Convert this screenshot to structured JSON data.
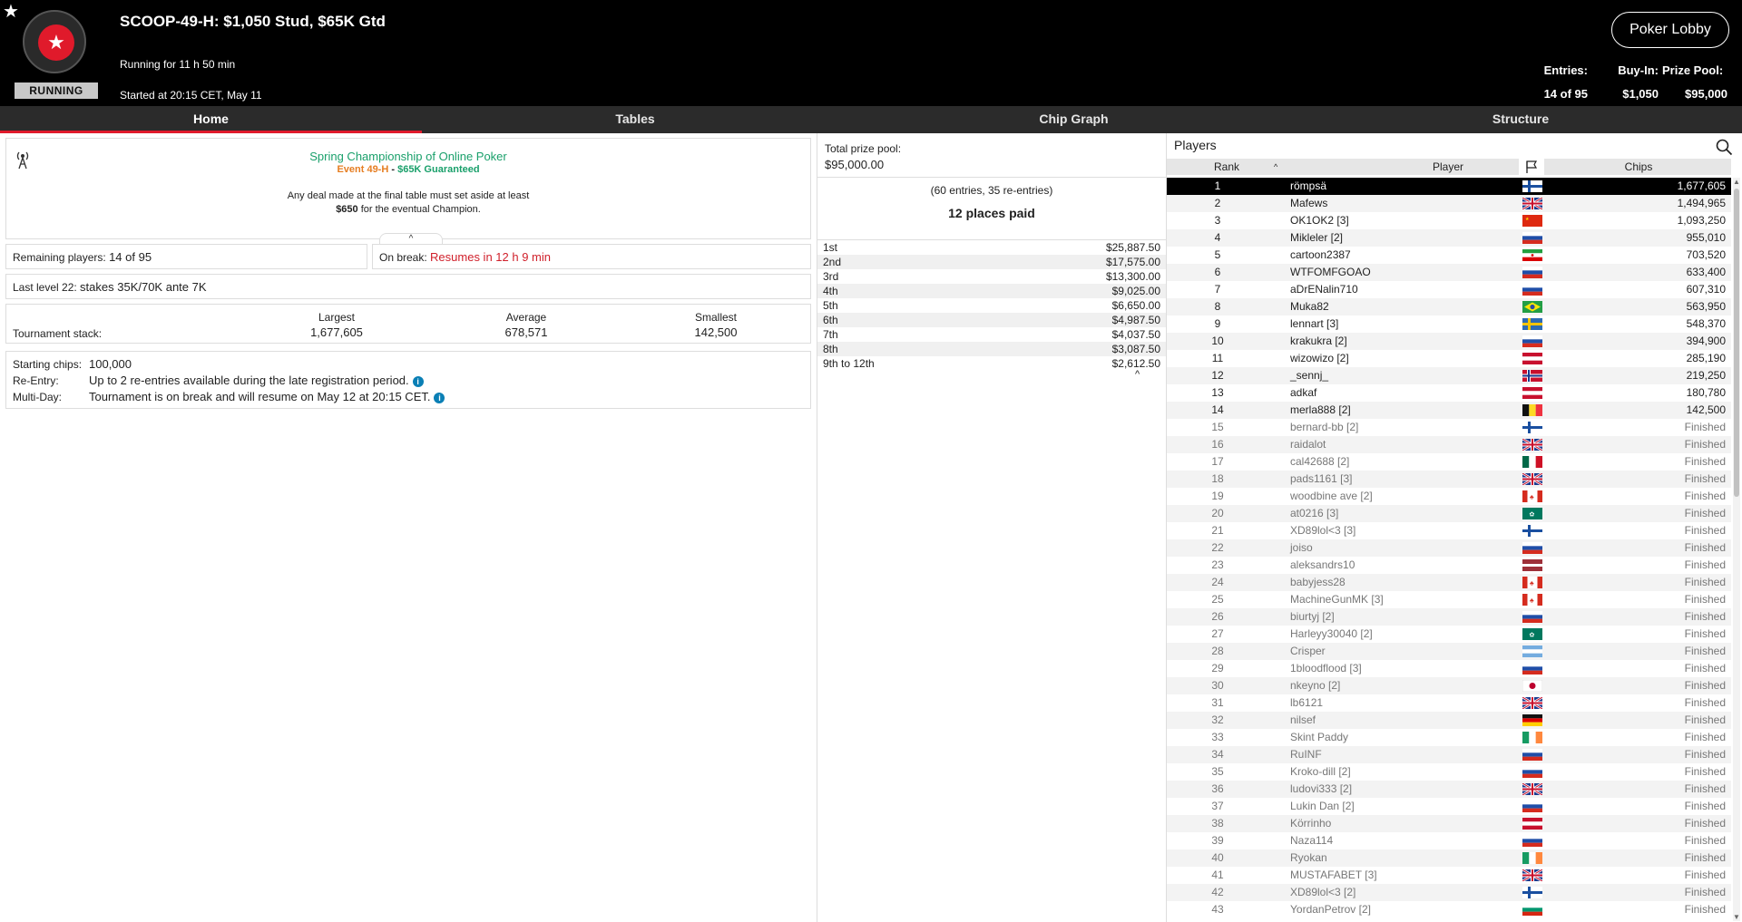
{
  "header": {
    "title": "SCOOP-49-H: $1,050 Stud, $65K Gtd",
    "running_for": "Running for 11 h 50 min",
    "started_at": "Started at 20:15 CET, May 11",
    "status_badge": "RUNNING",
    "lobby_button": "Poker Lobby",
    "stats": [
      {
        "label": "Entries:",
        "value": "14 of 95"
      },
      {
        "label": "Buy-In:",
        "value": "$1,050"
      },
      {
        "label": "Prize Pool:",
        "value": "$95,000"
      }
    ]
  },
  "tabs": [
    {
      "label": "Home",
      "active": true
    },
    {
      "label": "Tables",
      "active": false
    },
    {
      "label": "Chip Graph",
      "active": false
    },
    {
      "label": "Structure",
      "active": false
    }
  ],
  "promo": {
    "title": "Spring Championship of Online Poker",
    "event": "Event 49-H",
    "separator": " - ",
    "guarantee": "$65K Guaranteed",
    "deal_line1": "Any deal made at the final table must set aside at least",
    "deal_amount": "$650",
    "deal_line2": " for the eventual Champion."
  },
  "status": {
    "remaining_label": "Remaining players: ",
    "remaining_value": "14 of 95",
    "onbreak_label": "On break: ",
    "onbreak_value": "Resumes in 12 h 9 min",
    "lastlevel_label": "Last level 22: ",
    "lastlevel_value": "stakes 35K/70K ante 7K"
  },
  "stacks": {
    "row_label": "Tournament stack:",
    "largest_label": "Largest",
    "largest": "1,677,605",
    "average_label": "Average",
    "average": "678,571",
    "smallest_label": "Smallest",
    "smallest": "142,500"
  },
  "info": {
    "starting_chips_label": "Starting chips:",
    "starting_chips": "100,000",
    "reentry_label": "Re-Entry:",
    "reentry": "Up to 2 re-entries available during the late registration period.",
    "multiday_label": "Multi-Day:",
    "multiday": "Tournament is on break and will resume on May 12 at 20:15 CET."
  },
  "prizes": {
    "total_label": "Total prize pool:",
    "total_value": "$95,000.00",
    "entries_note": "(60 entries, 35 re-entries)",
    "places_paid": "12 places paid",
    "payouts": [
      {
        "place": "1st",
        "amount": "$25,887.50"
      },
      {
        "place": "2nd",
        "amount": "$17,575.00"
      },
      {
        "place": "3rd",
        "amount": "$13,300.00"
      },
      {
        "place": "4th",
        "amount": "$9,025.00"
      },
      {
        "place": "5th",
        "amount": "$6,650.00"
      },
      {
        "place": "6th",
        "amount": "$4,987.50"
      },
      {
        "place": "7th",
        "amount": "$4,037.50"
      },
      {
        "place": "8th",
        "amount": "$3,087.50"
      },
      {
        "place": "9th to 12th",
        "amount": "$2,612.50"
      }
    ]
  },
  "players": {
    "title": "Players",
    "columns": {
      "rank": "Rank",
      "player": "Player",
      "chips": "Chips"
    },
    "rows": [
      {
        "rank": "1",
        "name": "römpsä",
        "flag": "fi",
        "chips": "1,677,605"
      },
      {
        "rank": "2",
        "name": "Mafews",
        "flag": "gb",
        "chips": "1,494,965"
      },
      {
        "rank": "3",
        "name": "OK1OK2 [3]",
        "flag": "cn",
        "chips": "1,093,250"
      },
      {
        "rank": "4",
        "name": "Mikleler [2]",
        "flag": "ru",
        "chips": "955,010"
      },
      {
        "rank": "5",
        "name": "cartoon2387",
        "flag": "ir",
        "chips": "703,520"
      },
      {
        "rank": "6",
        "name": "WTFOMFGOAO",
        "flag": "ru",
        "chips": "633,400"
      },
      {
        "rank": "7",
        "name": "aDrENalin710",
        "flag": "ru",
        "chips": "607,310"
      },
      {
        "rank": "8",
        "name": "Muka82",
        "flag": "br",
        "chips": "563,950"
      },
      {
        "rank": "9",
        "name": "lennart [3]",
        "flag": "se",
        "chips": "548,370"
      },
      {
        "rank": "10",
        "name": "krakukra [2]",
        "flag": "ru",
        "chips": "394,900"
      },
      {
        "rank": "11",
        "name": "wizowizo [2]",
        "flag": "at",
        "chips": "285,190"
      },
      {
        "rank": "12",
        "name": "_sennj_",
        "flag": "no",
        "chips": "219,250"
      },
      {
        "rank": "13",
        "name": "adkaf",
        "flag": "at",
        "chips": "180,780"
      },
      {
        "rank": "14",
        "name": "merla888 [2]",
        "flag": "be",
        "chips": "142,500"
      },
      {
        "rank": "15",
        "name": "bernard-bb [2]",
        "flag": "fi",
        "chips": "Finished"
      },
      {
        "rank": "16",
        "name": "raidalot",
        "flag": "gb",
        "chips": "Finished"
      },
      {
        "rank": "17",
        "name": "cal42688 [2]",
        "flag": "mx",
        "chips": "Finished"
      },
      {
        "rank": "18",
        "name": "pads1161 [3]",
        "flag": "gb",
        "chips": "Finished"
      },
      {
        "rank": "19",
        "name": "woodbine ave [2]",
        "flag": "ca",
        "chips": "Finished"
      },
      {
        "rank": "20",
        "name": "at0216 [3]",
        "flag": "mo",
        "chips": "Finished"
      },
      {
        "rank": "21",
        "name": "XD89lol<3 [3]",
        "flag": "fi",
        "chips": "Finished"
      },
      {
        "rank": "22",
        "name": "joiso",
        "flag": "ru",
        "chips": "Finished"
      },
      {
        "rank": "23",
        "name": "aleksandrs10",
        "flag": "lv",
        "chips": "Finished"
      },
      {
        "rank": "24",
        "name": "babyjess28",
        "flag": "ca",
        "chips": "Finished"
      },
      {
        "rank": "25",
        "name": "MachineGunMK [3]",
        "flag": "ca",
        "chips": "Finished"
      },
      {
        "rank": "26",
        "name": "biurtyj [2]",
        "flag": "ru",
        "chips": "Finished"
      },
      {
        "rank": "27",
        "name": "Harleyy30040 [2]",
        "flag": "mo",
        "chips": "Finished"
      },
      {
        "rank": "28",
        "name": "Crisper",
        "flag": "ar",
        "chips": "Finished"
      },
      {
        "rank": "29",
        "name": "1bloodflood [3]",
        "flag": "ru",
        "chips": "Finished"
      },
      {
        "rank": "30",
        "name": "nkeyno [2]",
        "flag": "jp",
        "chips": "Finished"
      },
      {
        "rank": "31",
        "name": "lb6121",
        "flag": "gb",
        "chips": "Finished"
      },
      {
        "rank": "32",
        "name": "nilsef",
        "flag": "de",
        "chips": "Finished"
      },
      {
        "rank": "33",
        "name": "Skint Paddy",
        "flag": "ie",
        "chips": "Finished"
      },
      {
        "rank": "34",
        "name": "RuINF",
        "flag": "ru",
        "chips": "Finished"
      },
      {
        "rank": "35",
        "name": "Kroko-dill [2]",
        "flag": "ru",
        "chips": "Finished"
      },
      {
        "rank": "36",
        "name": "ludovi333 [2]",
        "flag": "gb",
        "chips": "Finished"
      },
      {
        "rank": "37",
        "name": "Lukin Dan [2]",
        "flag": "ru",
        "chips": "Finished"
      },
      {
        "rank": "38",
        "name": "Körrinho",
        "flag": "at",
        "chips": "Finished"
      },
      {
        "rank": "39",
        "name": "Naza114",
        "flag": "ru",
        "chips": "Finished"
      },
      {
        "rank": "40",
        "name": "Ryokan",
        "flag": "ie",
        "chips": "Finished"
      },
      {
        "rank": "41",
        "name": "MUSTAFABET [3]",
        "flag": "gb",
        "chips": "Finished"
      },
      {
        "rank": "42",
        "name": "XD89lol<3 [2]",
        "flag": "fi",
        "chips": "Finished"
      },
      {
        "rank": "43",
        "name": "YordanPetrov [2]",
        "flag": "bg",
        "chips": "Finished"
      }
    ]
  },
  "colors": {
    "accent_red": "#e01a2b",
    "green": "#1aa06b",
    "orange": "#e67e22",
    "info_blue": "#0a7fb5"
  }
}
